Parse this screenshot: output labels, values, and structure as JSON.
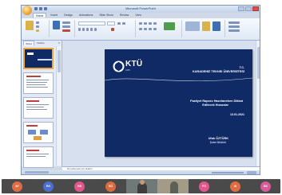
{
  "window": {
    "title": "Microsoft PowerPoint"
  },
  "ribbon": {
    "tabs": [
      "Home",
      "Insert",
      "Design",
      "Animations",
      "Slide Show",
      "Review",
      "View"
    ]
  },
  "slide_pane": {
    "tabs": [
      "Slides",
      "Outline"
    ],
    "thumb_numbers": [
      "1",
      "2",
      "3",
      "4",
      "5"
    ]
  },
  "slide": {
    "logo_text": "KTÜ",
    "logo_sub": "1955",
    "tc": "T.C.",
    "university": "KARADENİZ TEKNİK ÜNİVERSİTESİ",
    "title_line1": "Faaliyet Raporu Hazırlanırken Dikkat",
    "title_line2": "Edilecek Hususlar",
    "date": "13.01.2021",
    "presenter_name": "Ufuk ÖZTÜRK",
    "presenter_role": "Şube Müdürü"
  },
  "notes": {
    "placeholder": "Not eklemek için tıklatın"
  },
  "participants": [
    {
      "initials": "AY",
      "color": "#e06d42"
    },
    {
      "initials": "EG",
      "color": "#4a6fd1"
    },
    {
      "initials": "OK",
      "color": "#e0568d"
    },
    {
      "initials": "SÖ",
      "color": "#d96b3f"
    },
    {
      "initials": "",
      "camera": true
    },
    {
      "initials": "",
      "camera": true
    },
    {
      "initials": "FO",
      "color": "#e0568d"
    },
    {
      "initials": "AI",
      "color": "#e06d42"
    },
    {
      "initials": "DK",
      "color": "#d85a9a"
    }
  ]
}
